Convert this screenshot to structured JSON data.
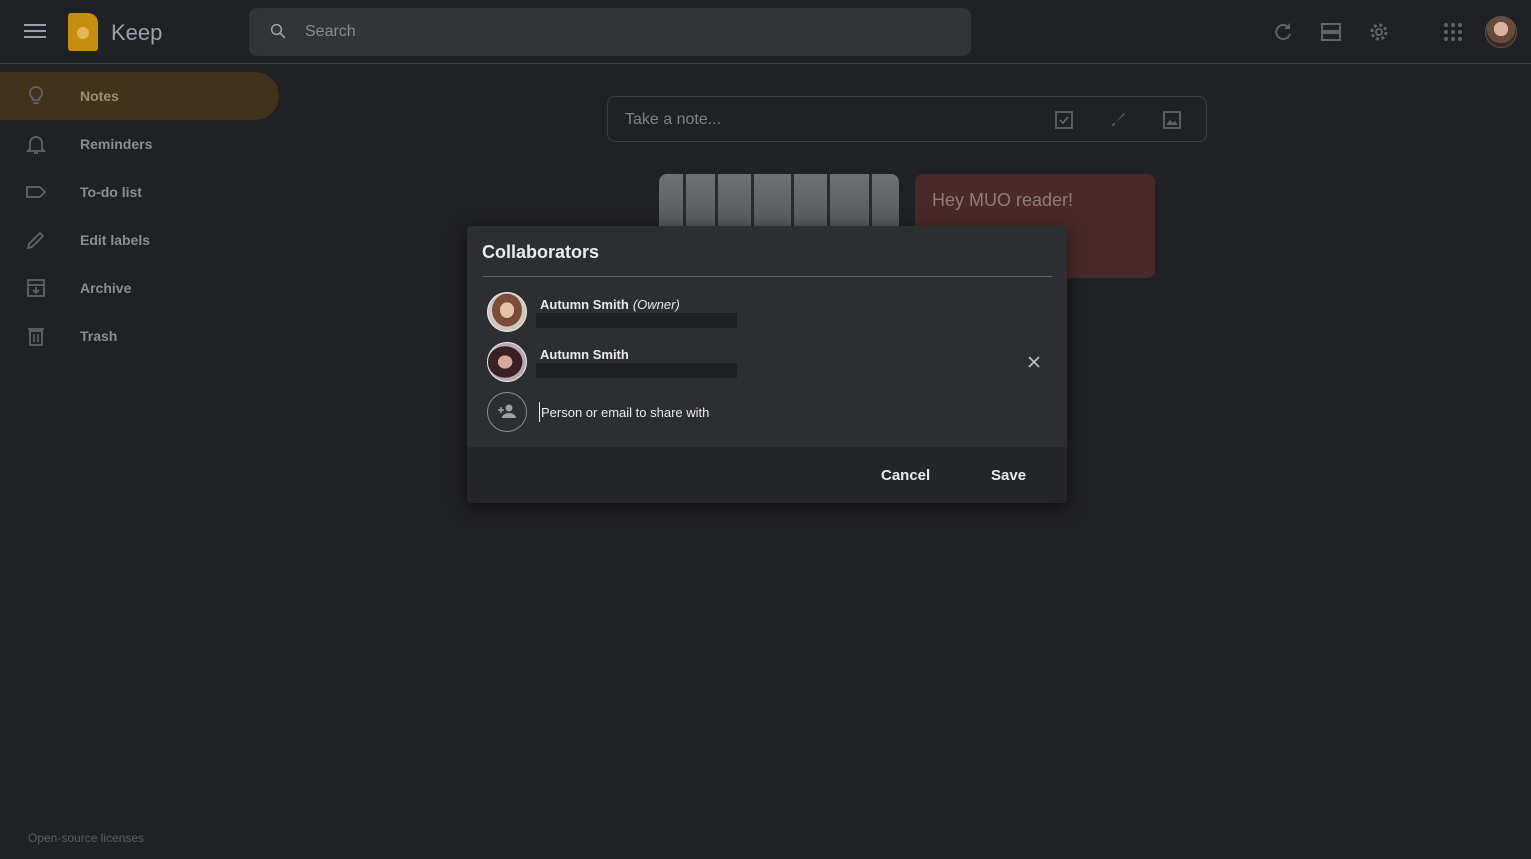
{
  "header": {
    "app_title": "Keep",
    "search_placeholder": "Search",
    "icons": [
      "menu-icon",
      "refresh-icon",
      "list-view-icon",
      "settings-icon",
      "apps-icon"
    ]
  },
  "sidebar": {
    "items": [
      {
        "label": "Notes",
        "icon": "lightbulb-icon",
        "active": true
      },
      {
        "label": "Reminders",
        "icon": "bell-icon"
      },
      {
        "label": "To-do list",
        "icon": "label-icon"
      },
      {
        "label": "Edit labels",
        "icon": "pencil-icon"
      },
      {
        "label": "Archive",
        "icon": "archive-icon"
      },
      {
        "label": "Trash",
        "icon": "trash-icon"
      }
    ],
    "footer_link": "Open-source licenses"
  },
  "main": {
    "take_note_placeholder": "Take a note...",
    "note_title": "Hey MUO reader!"
  },
  "dialog": {
    "title": "Collaborators",
    "collaborators": [
      {
        "name": "Autumn Smith",
        "role": "(Owner)"
      },
      {
        "name": "Autumn Smith",
        "role": ""
      }
    ],
    "add_placeholder": "Person or email to share with",
    "cancel_label": "Cancel",
    "save_label": "Save"
  },
  "colors": {
    "background": "#202124",
    "active_nav": "#41331b",
    "dialog": "#2d2e30",
    "note_red": "#4a2a29",
    "logo": "#c68e0f"
  }
}
